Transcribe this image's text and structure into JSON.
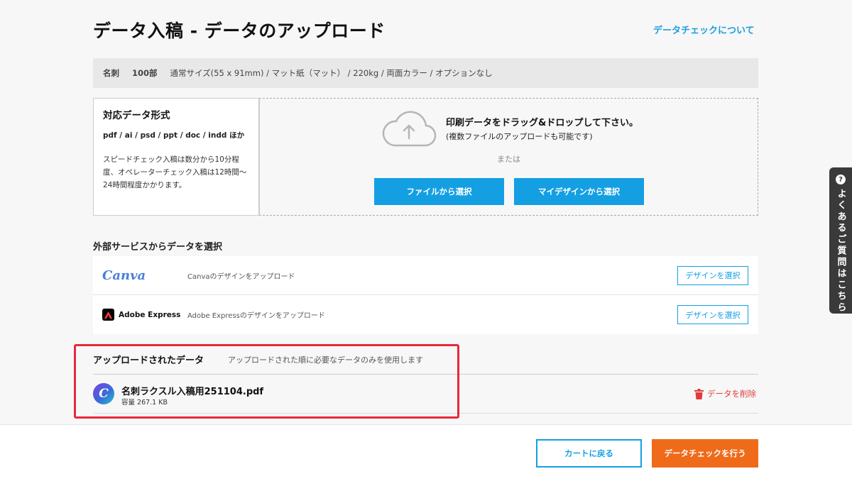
{
  "header": {
    "title": "データ入稿 - データのアップロード",
    "help_link": "データチェックについて"
  },
  "order": {
    "product": "名刺",
    "quantity": "100部",
    "spec": "通常サイズ(55 x 91mm) / マット紙（マット） / 220kg / 両面カラー / オプションなし"
  },
  "formats": {
    "title": "対応データ形式",
    "list": "pdf / ai / psd / ppt / doc / indd ほか",
    "note": "スピードチェック入稿は数分から10分程度、オペレーターチェック入稿は12時間〜24時間程度かかります。"
  },
  "dropzone": {
    "main_text": "印刷データをドラッグ&ドロップして下さい。",
    "sub_text": "(複数ファイルのアップロードも可能です)",
    "or_text": "または",
    "file_button": "ファイルから選択",
    "mydesign_button": "マイデザインから選択",
    "icon": "cloud-upload-icon"
  },
  "external": {
    "title": "外部サービスからデータを選択",
    "services": [
      {
        "logo": "Canva",
        "description": "Canvaのデザインをアップロード",
        "button": "デザインを選択"
      },
      {
        "logo": "Adobe Express",
        "description": "Adobe Expressのデザインをアップロード",
        "button": "デザインを選択"
      }
    ]
  },
  "uploaded": {
    "title": "アップロードされたデータ",
    "subtitle": "アップロードされた順に必要なデータのみを使用します",
    "file": {
      "icon_letter": "C",
      "name": "名刺ラクスル入稿用251104.pdf",
      "size": "容量 267.1 KB",
      "delete_label": "データを削除"
    }
  },
  "footer": {
    "back_button": "カートに戻る",
    "check_button": "データチェックを行う"
  },
  "faq": {
    "icon": "?",
    "label": "よくあるご質問はこちら"
  },
  "colors": {
    "accent_blue": "#149fe3",
    "orange": "#ef6b1a",
    "delete_red": "#e23a3a",
    "highlight_red": "#e8293c"
  }
}
